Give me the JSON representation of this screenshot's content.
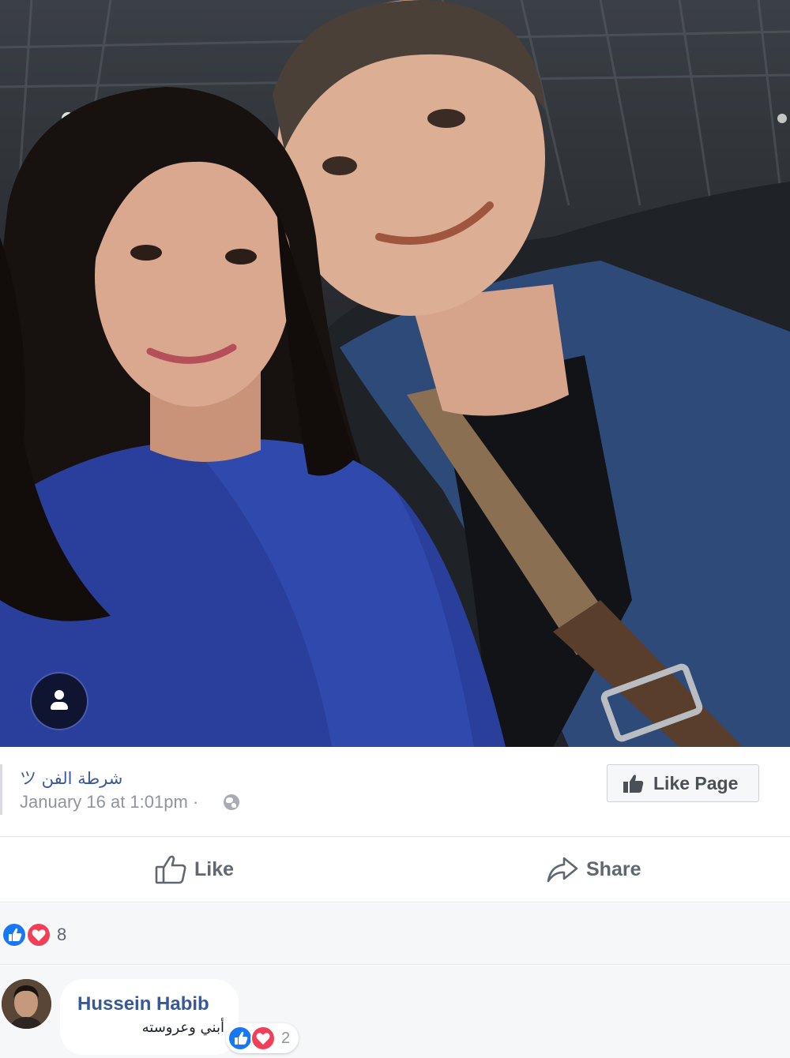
{
  "post": {
    "page_name": "شرطة الفن ツ",
    "timestamp": "January 16 at 1:01pm",
    "separator": "·",
    "privacy_icon": "globe-icon",
    "like_page_label": "Like Page"
  },
  "actions": {
    "like_label": "Like",
    "share_label": "Share"
  },
  "reactions": {
    "types": [
      "like",
      "love"
    ],
    "count": "8"
  },
  "comment": {
    "author": "Hussein Habib",
    "text": "أبني وعروسته",
    "reaction_types": [
      "like",
      "love"
    ],
    "reaction_count": "2"
  },
  "colors": {
    "brand_blue": "#3b5998",
    "like_blue": "#1877f2",
    "love_red": "#f33e58",
    "muted_text": "#90949c"
  }
}
